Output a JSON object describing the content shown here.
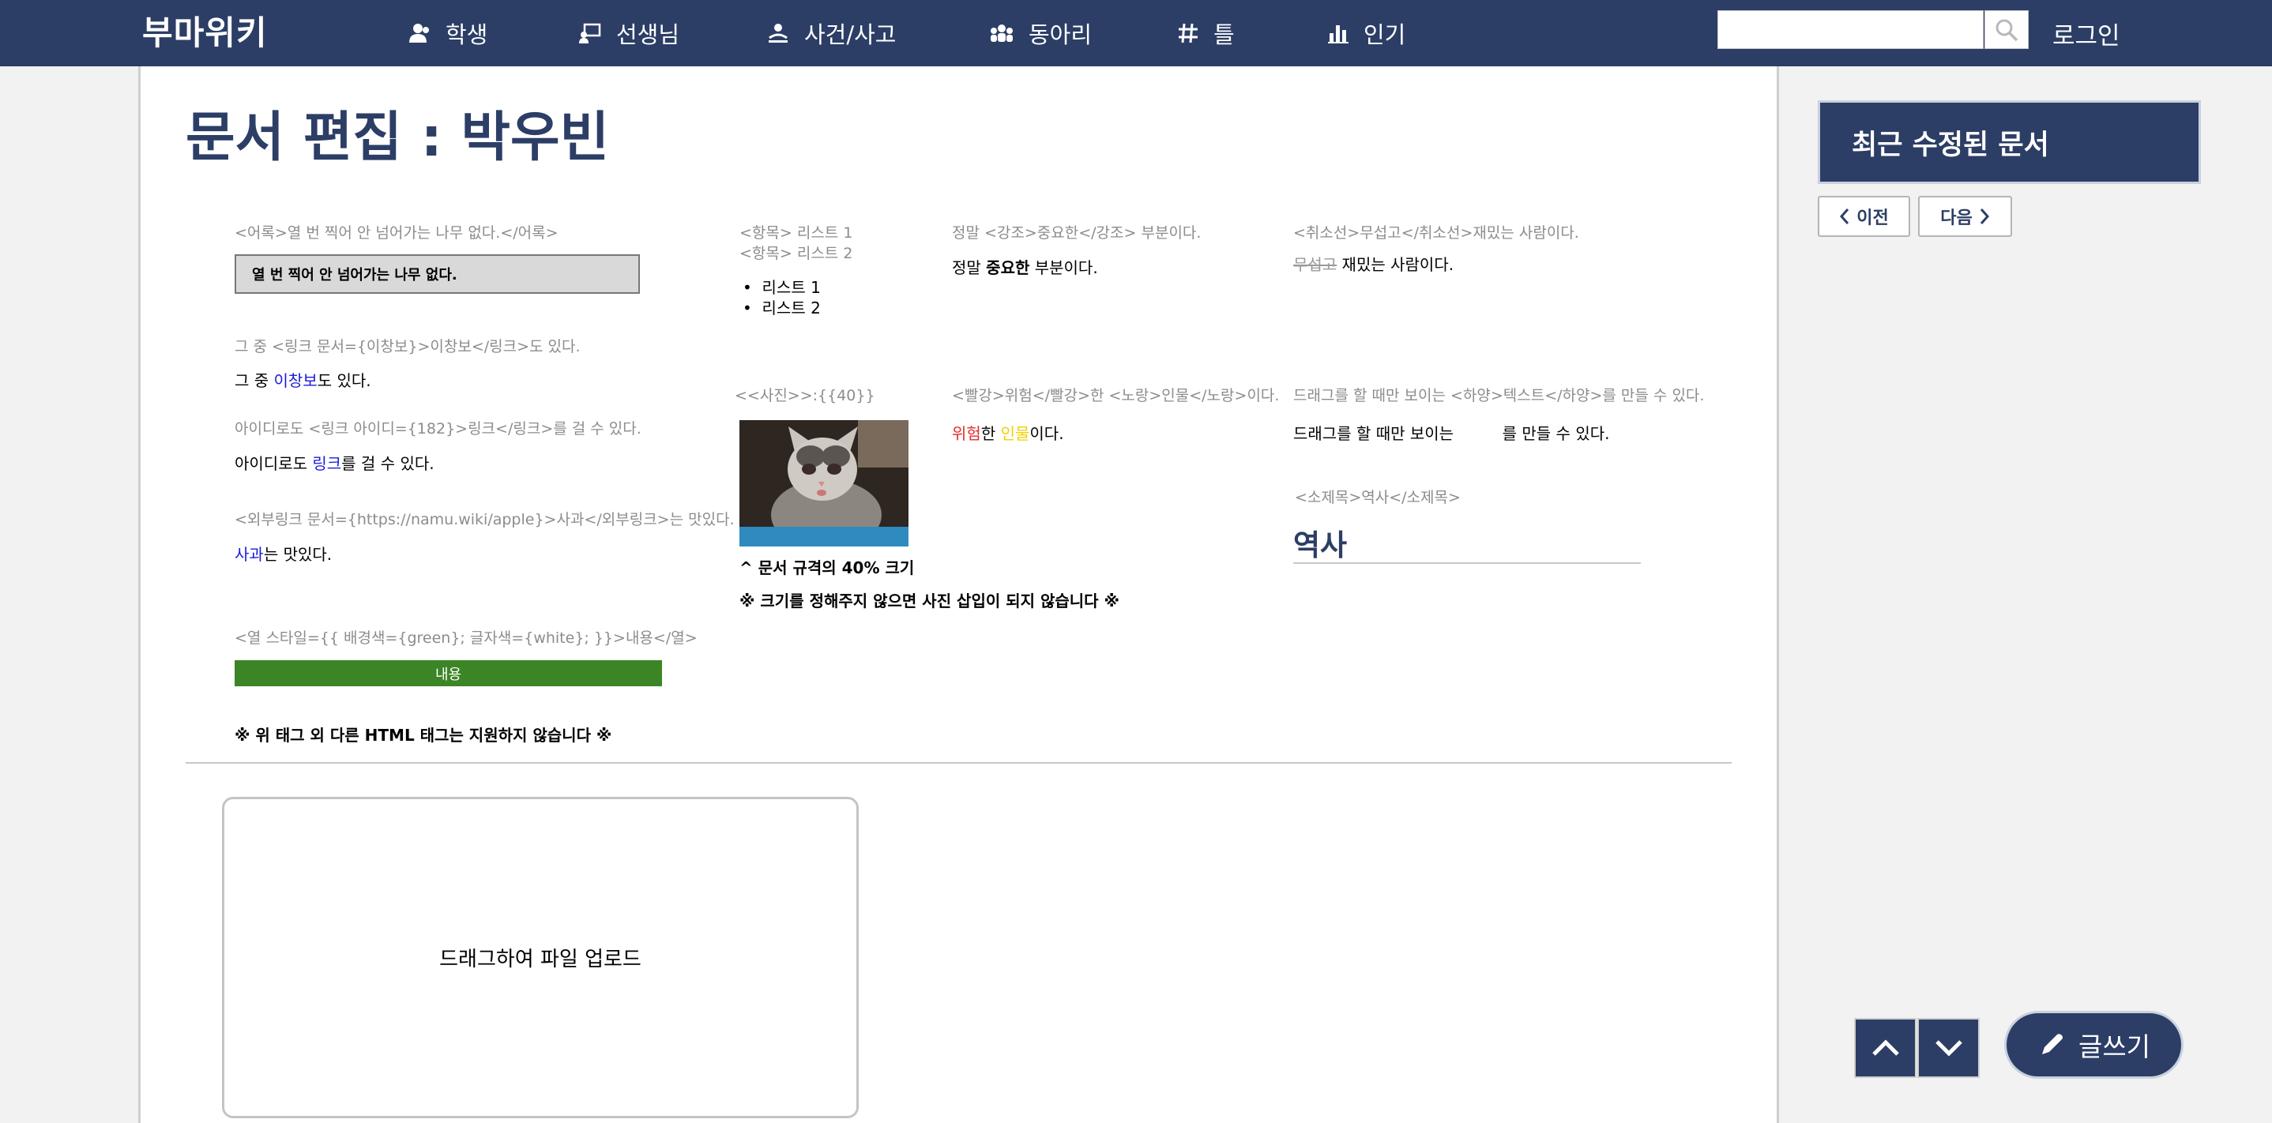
{
  "header": {
    "logo_text": "부마위키",
    "nav": [
      {
        "label": "학생",
        "icon": "user-icon"
      },
      {
        "label": "선생님",
        "icon": "teacher-icon"
      },
      {
        "label": "사건/사고",
        "icon": "incident-icon"
      },
      {
        "label": "동아리",
        "icon": "club-icon"
      },
      {
        "label": "틀",
        "icon": "hash-icon"
      },
      {
        "label": "인기",
        "icon": "chart-icon"
      }
    ],
    "search_value": "",
    "login_label": "로그인"
  },
  "page": {
    "title": "문서 편집 : 박우빈"
  },
  "guide": {
    "quote_tag": "<어록>열 번 찍어 안 넘어가는 나무 없다.</어록>",
    "quote_text": "열 번 찍어 안 넘어가는 나무 없다.",
    "link_tag": "그 중 <링크 문서={이창보}>이창보</링크>도 있다.",
    "link_pre": "그 중 ",
    "link_word": "이창보",
    "link_post": "도 있다.",
    "id_link_tag": "아이디로도 <링크 아이디={182}>링크</링크>를 걸 수 있다.",
    "id_link_pre": "아이디로도 ",
    "id_link_word": "링크",
    "id_link_post": "를 걸 수 있다.",
    "ext_link_tag": "<외부링크 문서={https://namu.wiki/apple}>사과</외부링크>는 맛있다.",
    "ext_link_word": "사과",
    "ext_link_post": "는 맛있다.",
    "col_style_tag": "<열 스타일={{ 배경색={green}; 글자색={white}; }}>내용</열>",
    "col_style_content": "내용",
    "footer_note": "※ 위 태그 외 다른 HTML 태그는 지원하지 않습니다 ※",
    "list_tag_1": "<항목> 리스트 1",
    "list_tag_2": "<항목> 리스트 2",
    "list_items": [
      "리스트 1",
      "리스트 2"
    ],
    "photo_tag": "<<사진>>:{{40}}",
    "photo_caption_1": "^ 문서 규격의 40% 크기",
    "photo_caption_2": "※ 크기를 정해주지 않으면 사진 삽입이 되지 않습니다 ※",
    "em_tag": "정말 <강조>중요한</강조> 부분이다.",
    "em_pre": "정말 ",
    "em_word": "중요한",
    "em_post": " 부분이다.",
    "color_tag": "<빨강>위험</빨강>한 <노랑>인물</노랑>이다.",
    "red_word": "위험",
    "mid_text": "한 ",
    "yellow_word": "인물",
    "color_post": "이다.",
    "strike_tag": "<취소선>무섭고</취소선>재밌는 사람이다.",
    "strike_word": "무섭고",
    "strike_post": " 재밌는 사람이다.",
    "hidden_tag": "드래그를 할 때만 보이는 <하양>텍스트</하양>를 만들 수 있다.",
    "hidden_pre": "드래그를 할 때만 보이는 ",
    "hidden_word": "텍스트",
    "hidden_post": "를 만들 수 있다.",
    "subtitle_tag": "<소제목>역사</소제목>",
    "subtitle_text": "역사"
  },
  "upload": {
    "label": "드래그하여 파일 업로드"
  },
  "sidebar": {
    "recent_title": "최근 수정된 문서",
    "prev_label": "이전",
    "next_label": "다음"
  },
  "float": {
    "write_label": "글쓰기"
  },
  "colors": {
    "primary": "#2c3e66",
    "link": "#1a1adb",
    "red": "#e32d2d",
    "yellow": "#f0d000",
    "green": "#3c8526"
  }
}
